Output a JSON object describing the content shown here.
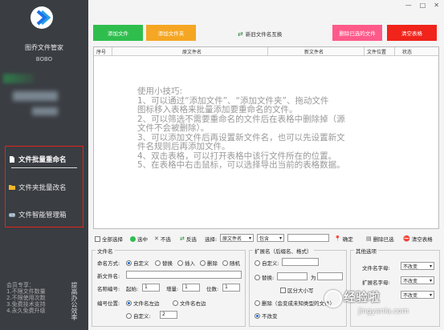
{
  "sidebar": {
    "app_title": "图乔文件管家",
    "user_name": "BOBO",
    "nav": [
      {
        "label": "文件批量重命名",
        "icon": "file-icon"
      },
      {
        "label": "文件夹批量改名",
        "icon": "folder-icon"
      },
      {
        "label": "文件智能管理箱",
        "icon": "gamepad-icon"
      }
    ],
    "vip_lines": [
      "会员专享：",
      "1.不限文件数量",
      "2.不限使用次数",
      "3.免费技术支持",
      "4.永久免费升级"
    ],
    "vertical_text": "提高办公效率"
  },
  "window": {
    "minimize": "—",
    "maximize": "□",
    "close": "✕"
  },
  "toolbar": {
    "add_file": "添加文件",
    "add_folder": "添加文件夹",
    "swap_names": "新旧文件名互换",
    "delete_used": "删除已选的文件",
    "clear_table": "清空表格"
  },
  "table": {
    "headers": [
      "序号",
      "原文件名",
      "新文件名",
      "文件位置",
      "状态"
    ],
    "tips": [
      "使用小技巧:",
      "1、可以通过“添加文件”、“添加文件夹”、拖动文件",
      "图标移入表格来批量添加要重命名的文件。",
      "2、可以筛选不需要重命名的文件后在表格中删除掉（源",
      "文件不会被删除）。",
      "3、可以添加文件后再设置新文件名，也可以先设置新文",
      "件名规则后再添加文件。",
      "4、双击表格，可以打开表格中该行文件所在的位置。",
      "5、在表格中右击鼠标，可以选择导出当前的表格数据。"
    ]
  },
  "filter": {
    "select_all": "全部选择",
    "select": "选中",
    "deselect": "不选",
    "invert": "反选",
    "choose_label": "选择:",
    "field_value": "原文件名",
    "match_value": "包含",
    "match_input": "",
    "confirm": "确定",
    "delete_rows": "删除已选",
    "clear_table": "清空表格"
  },
  "filename_group": {
    "title": "文件名",
    "naming_label": "命名方式:",
    "options": [
      "自定义",
      "替换",
      "插入",
      "删除",
      "随机"
    ],
    "new_name_label": "新文件名:",
    "new_name_value": "",
    "num_label": "名称编号:",
    "start_label": "起始:",
    "start_value": "1",
    "step_label": "增量:",
    "step_value": "1",
    "digits_label": "位数:",
    "digits_value": "1",
    "pos_label": "编号位置:",
    "pos_left": "文件名左边",
    "pos_right": "文件名右边",
    "custom_label": "自定义:",
    "custom_value": "2"
  },
  "ext_group": {
    "title": "扩展名（后缀名、格式）",
    "custom": "自定义:",
    "replace": "替换:",
    "to": "为",
    "case_label": "区分大小写",
    "delete": "删除（会变成未知类型的文件）",
    "unchanged": "不改变"
  },
  "other_group": {
    "title": "其他选项",
    "name_case_label": "文件名字母:",
    "name_case_value": "不改变",
    "ext_case_label": "扩展名字母:",
    "ext_case_value": "不改变",
    "third_value": "不改变"
  },
  "watermark": {
    "text": "经验啦",
    "url": "jingyanla.com"
  },
  "colors": {
    "sidebar": "#3a3d42",
    "green": "#2fbe4e",
    "orange": "#f5a623",
    "pink": "#ff5a8a",
    "red": "#f0241b",
    "highlight": "#e0241b"
  }
}
